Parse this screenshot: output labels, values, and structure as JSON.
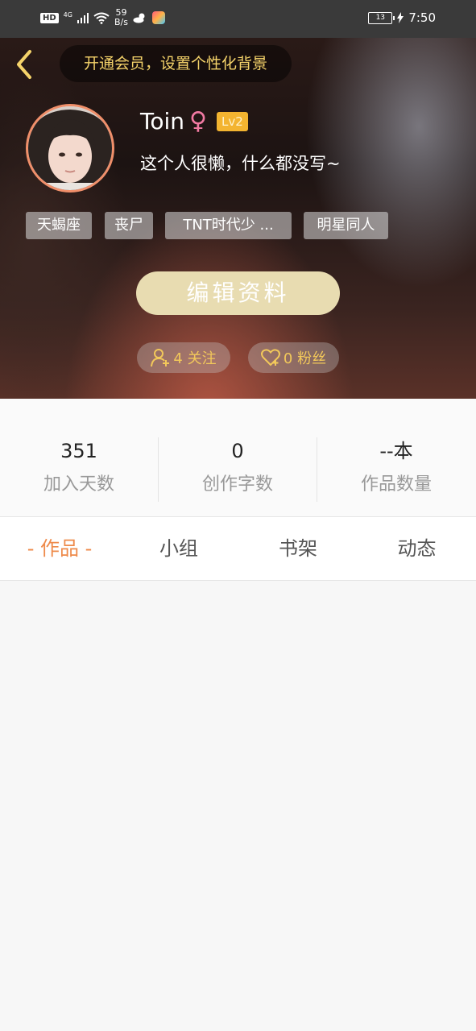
{
  "status_bar": {
    "hd": "HD",
    "network": "4G",
    "speed_value": "59",
    "speed_unit": "B/s",
    "battery": "13",
    "time": "7:50"
  },
  "header": {
    "back_icon": "chevron-left-icon",
    "vip_prompt": "开通会员，设置个性化背景",
    "username": "Toin",
    "gender_symbol": "♀",
    "level": "Lv2",
    "bio": "这个人很懒，什么都没写~",
    "tags": [
      "天蝎座",
      "丧尸",
      "TNT时代少 ...",
      "明星同人"
    ],
    "edit_button": "编辑资料",
    "following_label": "4 关注",
    "followers_label": "0 粉丝"
  },
  "stats": [
    {
      "value": "351",
      "label": "加入天数"
    },
    {
      "value": "0",
      "label": "创作字数"
    },
    {
      "value": "--本",
      "label": "作品数量"
    }
  ],
  "tabs": [
    {
      "label": "- 作品 -",
      "active": true
    },
    {
      "label": "小组",
      "active": false
    },
    {
      "label": "书架",
      "active": false
    },
    {
      "label": "动态",
      "active": false
    }
  ],
  "colors": {
    "accent": "#ee8a4a",
    "vip_text": "#f5d36a",
    "level_badge": "#f3b430",
    "avatar_border": "#f08f6a"
  }
}
